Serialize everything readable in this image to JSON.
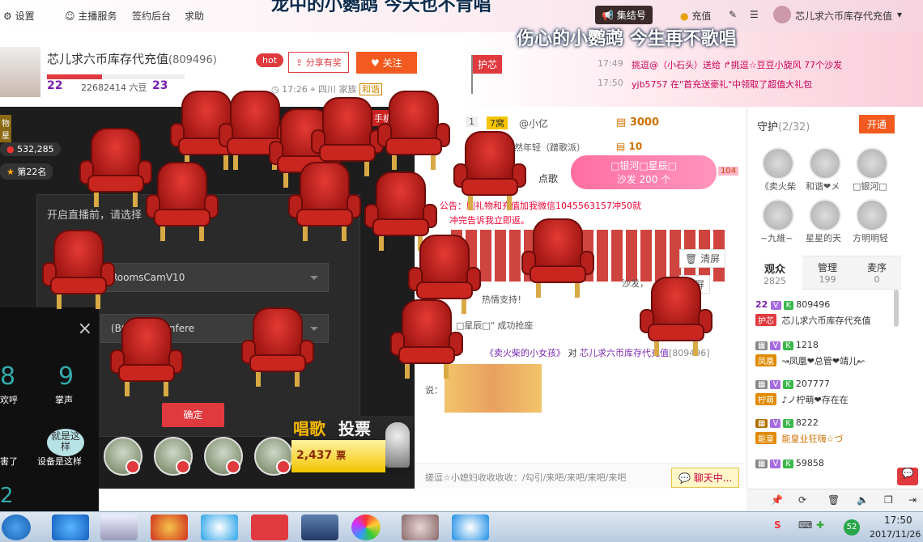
{
  "topbar": {
    "settings": "设置",
    "anchor_service": "主播服务",
    "sign_backend": "签约后台",
    "help": "求助",
    "gather": "集结号",
    "recharge": "充值",
    "user": "芯儿求六币库存代充值"
  },
  "lyrics": {
    "line1": "龙中的小鹦鹉 今天也不肯唱",
    "line2": "伤心的小鹦鹉 今生再不歌唱"
  },
  "host": {
    "name": "芯儿求六币库存代充值",
    "id": "(809496)",
    "level_left": "22",
    "beans": "22682414 六豆",
    "level_right": "23",
    "hot": "hot",
    "share": "分享有奖",
    "follow": "关注",
    "time": "17:26",
    "location": "四川",
    "family": "家族",
    "family_tag": "和谐",
    "guard_flag": "护芯"
  },
  "notices": [
    {
      "time": "17:49",
      "text": "挑逗@（小石头）送给 ↱挑逗☆豆豆小旋风 77个沙发"
    },
    {
      "time": "17:50",
      "text": "yjb5757 在\"首充送豪礼\"中领取了超值大礼包"
    }
  ],
  "left": {
    "fans": "532,285",
    "rank": "第22名",
    "badge": "物星",
    "tab": "手机"
  },
  "dialog": {
    "title": "开启直播前，请选择",
    "camera": "RoomsCamV10",
    "device": "(BCC950 Confere",
    "ok": "确定",
    "close": "×"
  },
  "sidepanel": {
    "num_left": "8",
    "num_right": "9",
    "label_left": "欢呼",
    "label_right": "掌声",
    "label3": "害了",
    "label4": "设备是这样",
    "label5": "就是这样",
    "num2": "2"
  },
  "vote": {
    "title_a": "唱歌",
    "title_b": "投票",
    "count": "2,437",
    "unit": "票"
  },
  "chat": {
    "rank_num": "1",
    "rank_tag": "7窝",
    "user": "@小亿",
    "coins": "3000",
    "line2": "依依然年轻（蹭歌派）",
    "coins2": "10",
    "tab": "点歌",
    "gift_line1": "□银河□星辰□",
    "gift_line2": "沙发 200 个",
    "gift_count": "104",
    "announce": "公告：刷礼物和充值加我微信1045563157冲50就",
    "announce2": "冲完告诉我立即返。",
    "clear1": "清屏",
    "clear2": "清屏",
    "sofa": "沙发，",
    "support": "热情支持！",
    "grab": "□星辰□\" 成功抢座",
    "from": "《卖火柴的小女孩》",
    "to_word": "对",
    "to": "芯儿求六币库存代充值",
    "to_id": "[809496]",
    "say": "说：",
    "bottom_msg": "搓逗☆小媳妇收收收收：/勾引/来吧/来吧/来吧/来吧",
    "chat_btn": "聊天中..."
  },
  "guard_panel": {
    "title": "守护",
    "count": "(2/32)",
    "open": "开通",
    "members": [
      {
        "label": "《卖火柴"
      },
      {
        "label": "和谐❤メ"
      },
      {
        "label": "□银河□"
      },
      {
        "label": "~九維~"
      },
      {
        "label": "星星的天"
      },
      {
        "label": "方明明轻"
      }
    ],
    "tabs": [
      {
        "label": "观众",
        "count": "2825"
      },
      {
        "label": "管理",
        "count": "199"
      },
      {
        "label": "麦序",
        "count": "0"
      }
    ],
    "viewers": [
      {
        "id": "809496",
        "name": "芯儿求六币库存代充值",
        "level": "22"
      },
      {
        "id": "1218",
        "name": "↝凤凰❤总管❤靖儿↜"
      },
      {
        "id": "207777",
        "name": "♪ノ柠萌❤存在在"
      },
      {
        "id": "8222",
        "name": "能皇业狂嗨☆づ"
      },
      {
        "id": "59858",
        "name": ""
      }
    ],
    "viewer_tags": [
      "护芯",
      "凤凰",
      "柠萌",
      "能皇"
    ]
  },
  "taskbar": {
    "time": "17:50",
    "date": "2017/11/26",
    "notif": "52"
  }
}
